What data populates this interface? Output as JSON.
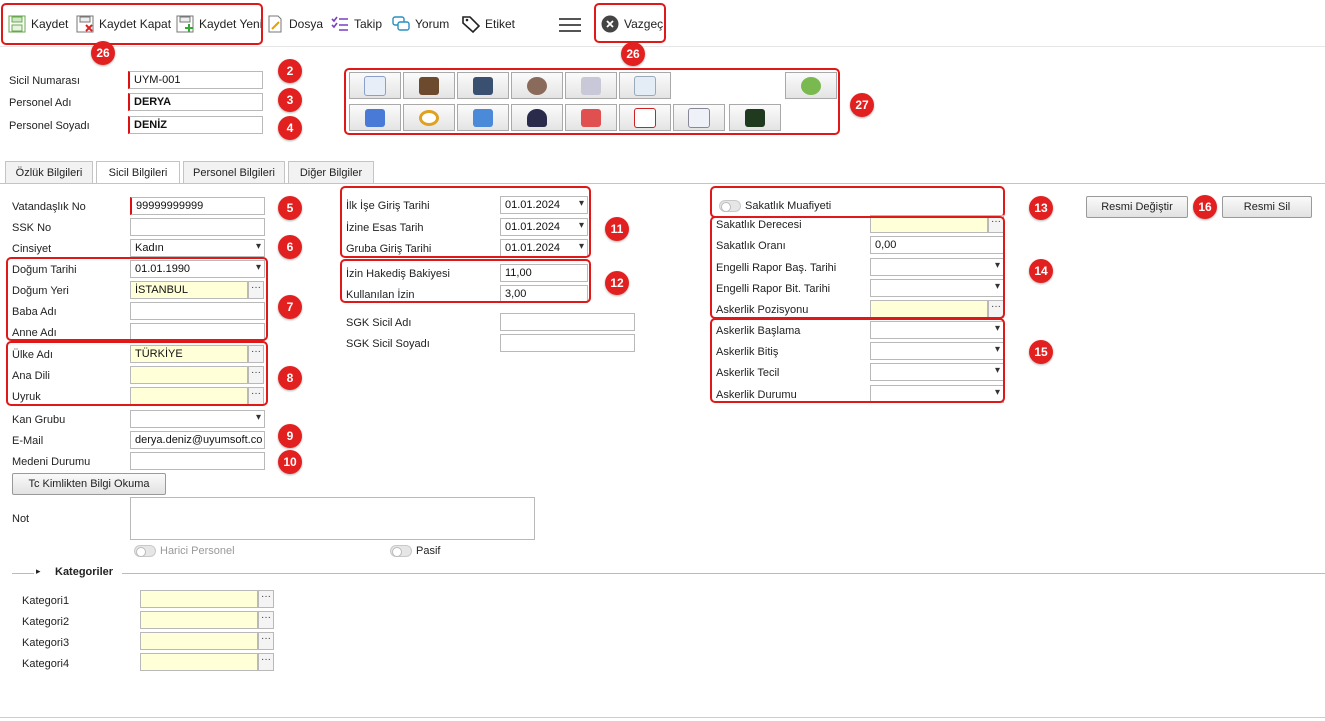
{
  "toolbar": {
    "save": "Kaydet",
    "save_close": "Kaydet Kapat",
    "save_new": "Kaydet Yeni",
    "file": "Dosya",
    "follow": "Takip",
    "comment": "Yorum",
    "tag": "Etiket",
    "cancel": "Vazgeç"
  },
  "header": {
    "registry_no_label": "Sicil Numarası",
    "registry_no_value": "UYM-001",
    "first_name_label": "Personel Adı",
    "first_name_value": "DERYA",
    "last_name_label": "Personel Soyadı",
    "last_name_value": "DENİZ"
  },
  "tabs": [
    {
      "label": "Özlük Bilgileri"
    },
    {
      "label": "Sicil Bilgileri"
    },
    {
      "label": "Personel Bilgileri"
    },
    {
      "label": "Diğer Bilgiler"
    }
  ],
  "left": {
    "citizen_no_label": "Vatandaşlık No",
    "citizen_no_value": "99999999999",
    "ssk_label": "SSK No",
    "gender_label": "Cinsiyet",
    "gender_value": "Kadın",
    "birth_date_label": "Doğum Tarihi",
    "birth_date_value": "01.01.1990",
    "birth_place_label": "Doğum Yeri",
    "birth_place_value": "İSTANBUL",
    "father_label": "Baba Adı",
    "mother_label": "Anne Adı",
    "country_label": "Ülke Adı",
    "country_value": "TÜRKİYE",
    "language_label": "Ana Dili",
    "nationality_label": "Uyruk",
    "blood_label": "Kan Grubu",
    "email_label": "E-Mail",
    "email_value": "derya.deniz@uyumsoft.co",
    "marital_label": "Medeni Durumu",
    "tc_button": "Tc Kimlikten Bilgi Okuma",
    "note_label": "Not",
    "external_label": "Harici Personel",
    "passive_label": "Pasif"
  },
  "middle": {
    "start_date_label": "İlk İşe Giriş Tarihi",
    "start_date_value": "01.01.2024",
    "leave_base_label": "İzine Esas Tarih",
    "leave_base_value": "01.01.2024",
    "group_entry_label": "Gruba Giriş Tarihi",
    "group_entry_value": "01.01.2024",
    "leave_balance_label": "İzin Hakediş Bakiyesi",
    "leave_balance_value": "11,00",
    "leave_used_label": "Kullanılan İzin",
    "leave_used_value": "3,00",
    "sgk_name_label": "SGK Sicil Adı",
    "sgk_surname_label": "SGK Sicil Soyadı"
  },
  "right": {
    "disability_exempt_label": "Sakatlık Muafiyeti",
    "disability_degree_label": "Sakatlık Derecesi",
    "disability_rate_label": "Sakatlık Oranı",
    "disability_rate_value": "0,00",
    "report_start_label": "Engelli Rapor Baş. Tarihi",
    "report_end_label": "Engelli Rapor Bit. Tarihi",
    "military_position_label": "Askerlik Pozisyonu",
    "military_start_label": "Askerlik Başlama",
    "military_end_label": "Askerlik Bitiş",
    "military_defer_label": "Askerlik Tecil",
    "military_status_label": "Askerlik Durumu",
    "change_photo": "Resmi Değiştir",
    "delete_photo": "Resmi Sil"
  },
  "categories": {
    "title": "Kategoriler",
    "items": [
      "Kategori1",
      "Kategori2",
      "Kategori3",
      "Kategori4"
    ]
  },
  "badges": [
    "26",
    "26",
    "2",
    "3",
    "4",
    "27",
    "5",
    "6",
    "7",
    "8",
    "9",
    "10",
    "11",
    "12",
    "13",
    "14",
    "15",
    "16"
  ],
  "colors": {
    "highlight": "#e01818",
    "badge": "#e22020",
    "required_field": "#ffffd8"
  }
}
